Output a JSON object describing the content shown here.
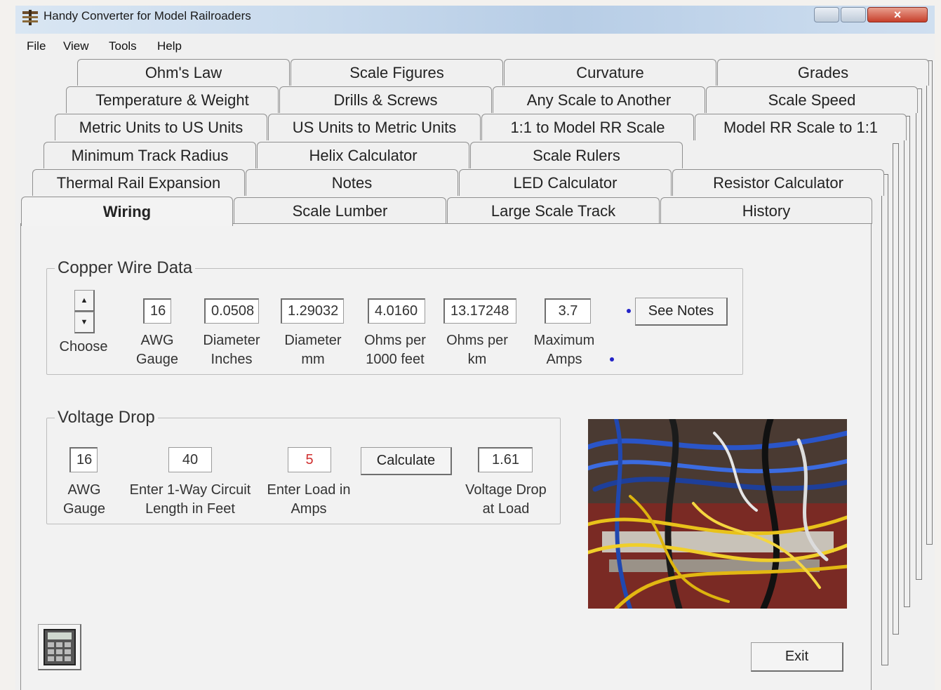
{
  "window": {
    "title": "Handy Converter for Model Railroaders"
  },
  "menu": [
    "File",
    "View",
    "Tools",
    "Help"
  ],
  "tabs": {
    "row1": [
      "Ohm's Law",
      "Scale Figures",
      "Curvature",
      "Grades"
    ],
    "row2": [
      "Temperature & Weight",
      "Drills & Screws",
      "Any Scale to Another",
      "Scale Speed"
    ],
    "row3": [
      "Metric Units to US Units",
      "US Units to Metric Units",
      "1:1 to Model RR Scale",
      "Model RR Scale to 1:1"
    ],
    "row4": [
      "Minimum Track Radius",
      "Helix Calculator",
      "Scale Rulers"
    ],
    "row5": [
      "Thermal Rail Expansion",
      "Notes",
      "LED Calculator",
      "Resistor Calculator"
    ],
    "row6": [
      "Wiring",
      "Scale Lumber",
      "Large Scale Track",
      "History"
    ],
    "selected": "Wiring"
  },
  "copper": {
    "title": "Copper Wire Data",
    "choose_label": "Choose",
    "awg": {
      "value": "16",
      "l1": "AWG",
      "l2": "Gauge"
    },
    "dia_in": {
      "value": "0.0508",
      "l1": "Diameter",
      "l2": "Inches"
    },
    "dia_mm": {
      "value": "1.29032",
      "l1": "Diameter",
      "l2": "mm"
    },
    "ohms_ft": {
      "value": "4.0160",
      "l1": "Ohms per",
      "l2": "1000 feet"
    },
    "ohms_km": {
      "value": "13.17248",
      "l1": "Ohms per",
      "l2": "km"
    },
    "amps": {
      "value": "3.7",
      "l1": "Maximum",
      "l2": "Amps"
    },
    "notes_button": "See Notes"
  },
  "vdrop": {
    "title": "Voltage Drop",
    "awg": {
      "value": "16",
      "l1": "AWG",
      "l2": "Gauge"
    },
    "length": {
      "value": "40",
      "l1": "Enter 1-Way Circuit",
      "l2": "Length in Feet"
    },
    "load": {
      "value": "5",
      "l1": "Enter Load in",
      "l2": "Amps"
    },
    "calc_button": "Calculate",
    "result": {
      "value": "1.61",
      "l1": "Voltage Drop",
      "l2": "at Load"
    }
  },
  "exit_button": "Exit",
  "colors": {
    "load_text": "#d03030",
    "dot": "#2323c8"
  }
}
